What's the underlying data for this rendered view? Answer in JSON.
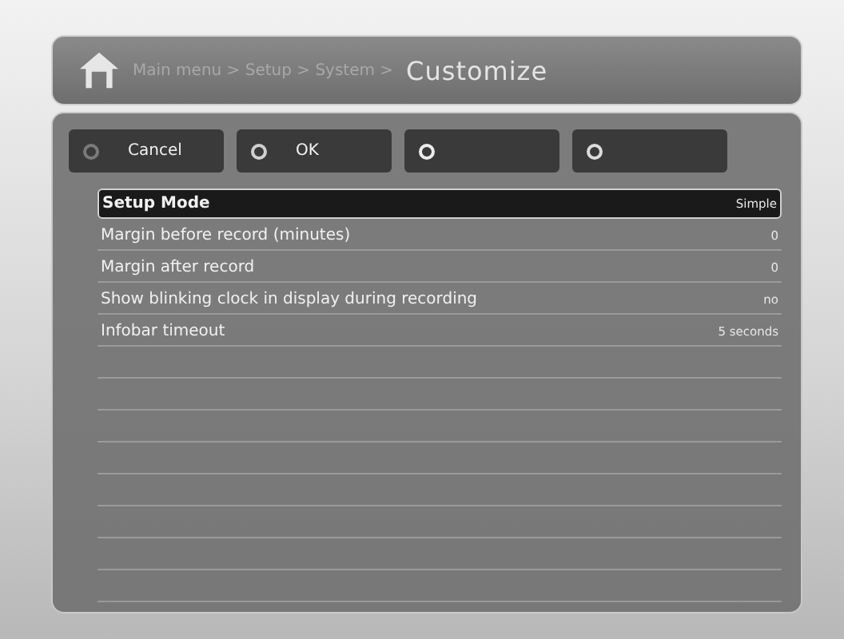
{
  "header": {
    "breadcrumb": "Main menu > Setup > System >",
    "title": "Customize"
  },
  "buttons": [
    {
      "label": "Cancel",
      "color": "#7a7a7a"
    },
    {
      "label": "OK",
      "color": "#d0d0d0"
    },
    {
      "color": "#ececec"
    },
    {
      "color": "#dcdcdc"
    }
  ],
  "settings": [
    {
      "label": "Setup Mode",
      "value": "Simple",
      "selected": true
    },
    {
      "label": "Margin before record (minutes)",
      "value": "0",
      "selected": false
    },
    {
      "label": "Margin after record",
      "value": "0",
      "selected": false
    },
    {
      "label": "Show blinking clock in display during recording",
      "value": "no",
      "selected": false
    },
    {
      "label": "Infobar timeout",
      "value": "5 seconds",
      "selected": false
    }
  ]
}
